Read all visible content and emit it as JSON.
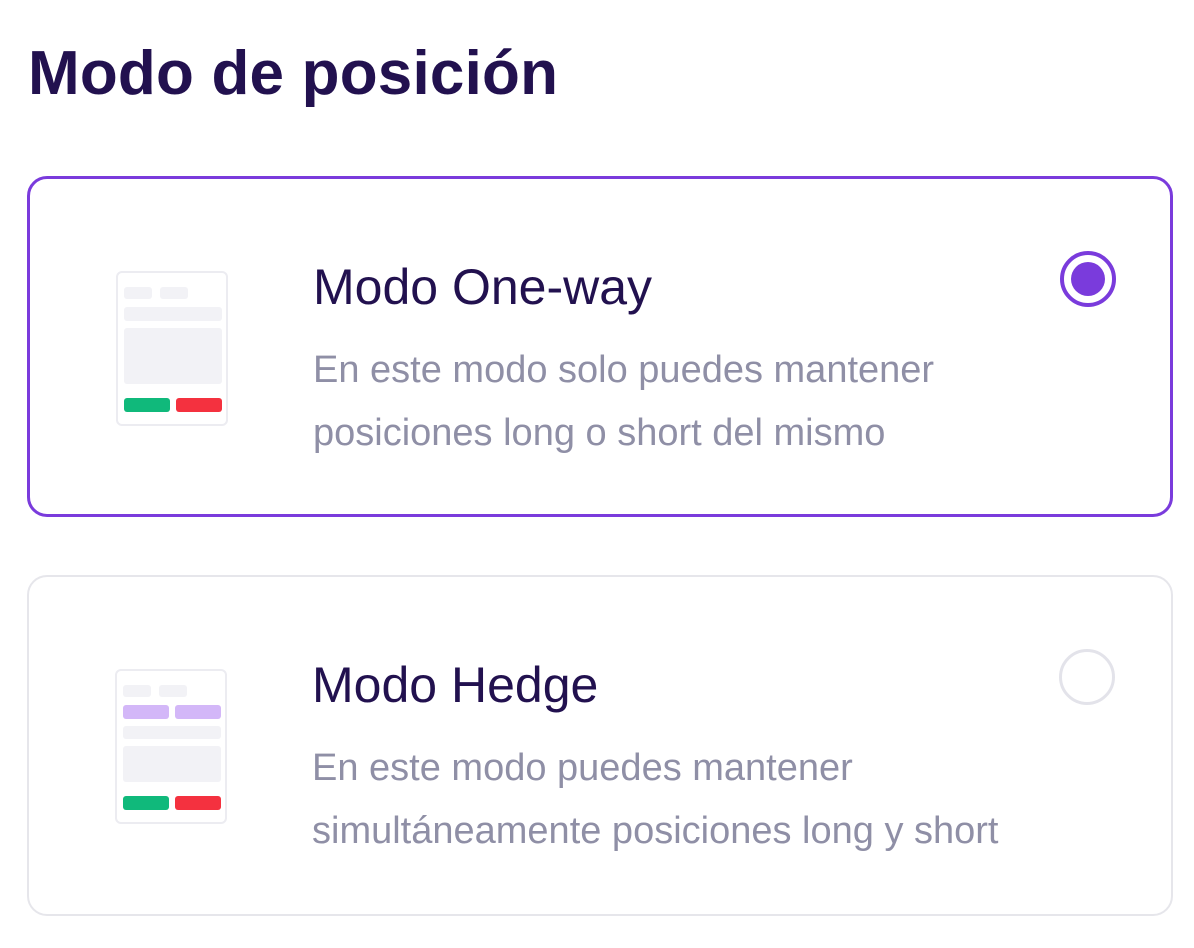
{
  "page": {
    "title": "Modo de posición"
  },
  "options": [
    {
      "id": "one-way",
      "title": "Modo One-way",
      "description_lines": [
        "En este modo solo puedes mantener",
        "posiciones long o short del mismo"
      ],
      "selected": true,
      "icon": "single-position-illustration-icon"
    },
    {
      "id": "hedge",
      "title": "Modo Hedge",
      "description_lines": [
        "En este modo puedes mantener",
        "simultáneamente posiciones long y short"
      ],
      "selected": false,
      "icon": "hedge-position-illustration-icon"
    }
  ],
  "colors": {
    "accent": "#7a3bdc",
    "title_text": "#22114f",
    "description_text": "#8f8fa6",
    "long_green": "#10b97b",
    "short_red": "#f4313f",
    "card_border": "#e6e6eb"
  }
}
